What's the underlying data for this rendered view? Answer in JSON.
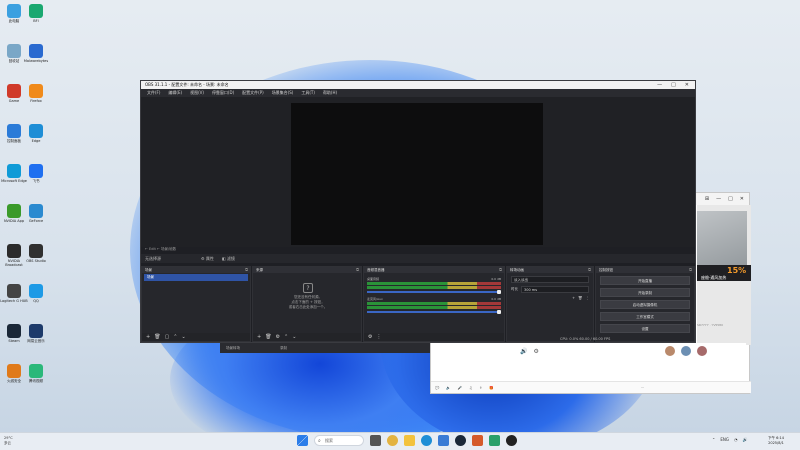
{
  "desktop": {
    "icons": [
      {
        "label": "此电脑",
        "color": "#3ba0e0"
      },
      {
        "label": "BFI",
        "color": "#1aa870"
      },
      {
        "label": "回收站",
        "color": "#7aa7c7"
      },
      {
        "label": "Malwarebytes",
        "color": "#2a6ad0"
      },
      {
        "label": "Game",
        "color": "#d03a2a"
      },
      {
        "label": "Firefox",
        "color": "#f08a1a"
      },
      {
        "label": "控制面板",
        "color": "#2b7bd8"
      },
      {
        "label": "Edge",
        "color": "#1e8ed6"
      },
      {
        "label": "Microsoft Edge",
        "color": "#0f9bd7"
      },
      {
        "label": "飞书",
        "color": "#1e6ff0"
      },
      {
        "label": "NVIDIA App",
        "color": "#3a9a2a"
      },
      {
        "label": "GeForce",
        "color": "#2a8ad0"
      },
      {
        "label": "NVIDIA Broadcast",
        "color": "#2b2b2b"
      },
      {
        "label": "OBS Studio",
        "color": "#303030"
      },
      {
        "label": "Logitech G HUB",
        "color": "#444444"
      },
      {
        "label": "QQ",
        "color": "#1d9ae6"
      },
      {
        "label": "Steam",
        "color": "#1b2838"
      },
      {
        "label": "网易云音乐",
        "color": "#1d3a6a"
      },
      {
        "label": "火绒安全",
        "color": "#e07a1a"
      },
      {
        "label": "腾讯视频",
        "color": "#2ab87a"
      }
    ]
  },
  "obs": {
    "title": "OBS 31.1.1 - 配置文件: 未命名 - 场景: 未命名",
    "menu": [
      "文件(F)",
      "编辑(E)",
      "视图(V)",
      "停靠窗口(D)",
      "配置文件(P)",
      "场景集合(S)",
      "工具(T)",
      "帮助(H)"
    ],
    "context_bar": "← Edit    ← 场景/帧数",
    "source_bar_label": "无选择源",
    "source_bar_props": "属性",
    "source_bar_filters": "滤镜",
    "scenes": {
      "title": "场景",
      "items": [
        "场景"
      ]
    },
    "sources": {
      "title": "来源",
      "empty_line1": "您还没有任何源。",
      "empty_line2": "点击下面的 + 按钮，",
      "empty_line3": "或者右击此处添加一个。"
    },
    "mixer": {
      "title": "音频混音器",
      "channels": [
        {
          "name": "桌面音频",
          "db": "0.0 dB"
        },
        {
          "name": "麦克风/Aux",
          "db": "0.0 dB"
        }
      ]
    },
    "transitions": {
      "title": "转场动画",
      "type": "淡入淡出",
      "duration_label": "时长",
      "duration": "300 ms"
    },
    "controls": {
      "title": "控制按钮",
      "buttons": [
        "开始直播",
        "开始录制",
        "启动虚拟摄像机",
        "工作室模式",
        "设置",
        "退出"
      ]
    },
    "status": "CPU: 0.0%  60.00 / 60.00 FPS",
    "dock_footer_icons": [
      "+",
      "🗑",
      "▢",
      "⌃",
      "⌄"
    ]
  },
  "browser": {
    "promo_percent": "15%",
    "promo_text": "座舱·通风加热",
    "numbers": "SR7777 · YV5580"
  },
  "strip": {
    "left": "场景转场",
    "right": "录制"
  },
  "taskbar": {
    "weather_temp": "29°C",
    "weather_desc": "多云",
    "search_placeholder": "搜索",
    "lang": "ENG",
    "clock_time": "下午 6:14",
    "clock_date": "2025/8/1"
  }
}
